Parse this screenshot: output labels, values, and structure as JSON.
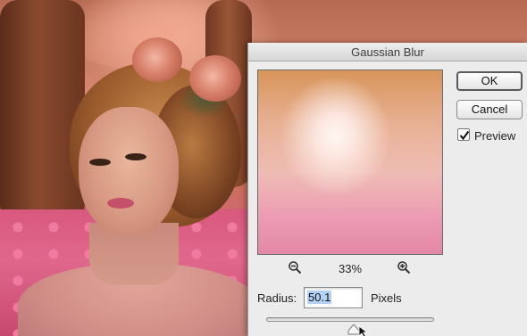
{
  "dialog": {
    "title": "Gaussian Blur",
    "ok_label": "OK",
    "cancel_label": "Cancel",
    "preview_label": "Preview",
    "preview_checked": true,
    "zoom_level": "33%",
    "zoom_out_icon": "zoom-out-icon",
    "zoom_in_icon": "zoom-in-icon",
    "radius_label": "Radius:",
    "radius_value": "50.1",
    "units_label": "Pixels",
    "radius_slider_level": 0.52
  },
  "background": {
    "description_icon": "portrait-photo"
  }
}
